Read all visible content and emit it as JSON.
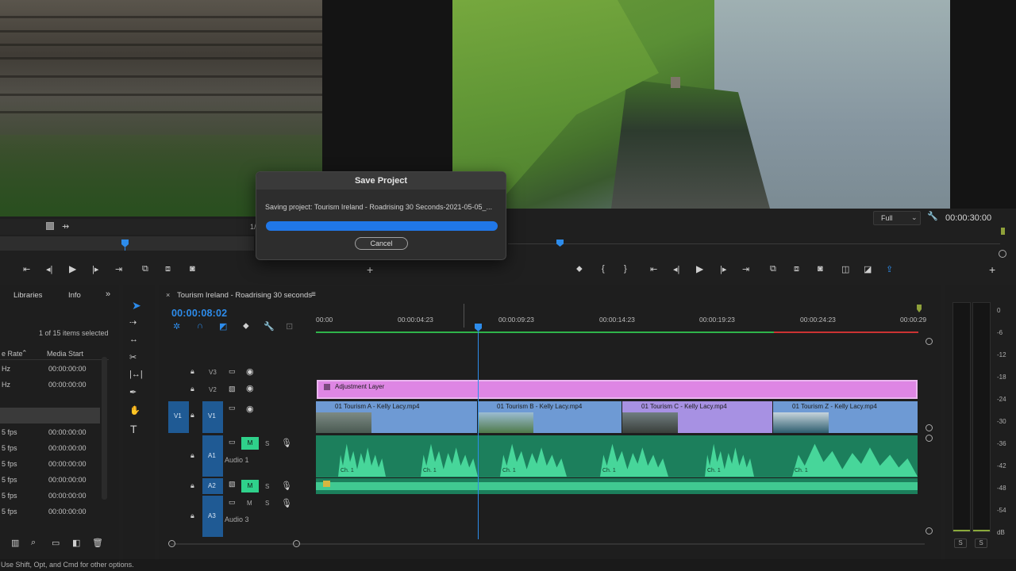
{
  "source_monitor": {
    "zoom_partial": "1/"
  },
  "program_monitor": {
    "resolution": "Full",
    "duration": "00:00:30:00"
  },
  "dialog": {
    "title": "Save Project",
    "message": "Saving project: Tourism Ireland - Roadrising 30 Seconds-2021-05-05_...",
    "progress_percent": 100,
    "cancel_label": "Cancel"
  },
  "project_panel": {
    "tabs": [
      "Libraries",
      "Info"
    ],
    "selection_info": "1 of 15 items selected",
    "columns": [
      "e Rate",
      "Media Start"
    ],
    "rows": [
      {
        "rate": "Hz",
        "start": "00:00:00:00"
      },
      {
        "rate": "Hz",
        "start": "00:00:00:00"
      },
      {
        "rate": "",
        "start": ""
      },
      {
        "rate": "5 fps",
        "start": "00:00:00:00"
      },
      {
        "rate": "5 fps",
        "start": "00:00:00:00"
      },
      {
        "rate": "5 fps",
        "start": "00:00:00:00"
      },
      {
        "rate": "5 fps",
        "start": "00:00:00:00"
      },
      {
        "rate": "5 fps",
        "start": "00:00:00:00"
      },
      {
        "rate": "5 fps",
        "start": "00:00:00:00"
      }
    ]
  },
  "timeline": {
    "sequence_name": "Tourism Ireland - Roadrising 30 seconds",
    "timecode": "00:00:08:02",
    "ruler": [
      "00:00",
      "00:00:04:23",
      "00:00:09:23",
      "00:00:14:23",
      "00:00:19:23",
      "00:00:24:23",
      "00:00:29"
    ],
    "tracks": {
      "v3": "V3",
      "v2": "V2",
      "v1": "V1",
      "v1_src": "V1",
      "a1": "A1",
      "a1_name": "Audio 1",
      "a2": "A2",
      "a3": "A3",
      "a3_name": "Audio 3",
      "m": "M",
      "s": "S"
    },
    "adjustment_layer": "Adjustment Layer",
    "video_clips": [
      "01 Tourism A - Kelly Lacy.mp4",
      "01 Tourism B - Kelly Lacy.mp4",
      "01 Tourism C - Kelly Lacy.mp4",
      "01 Tourism Z - Kelly Lacy.mp4"
    ],
    "channel_label": "Ch. 1"
  },
  "meter": {
    "labels": [
      "0",
      "-6",
      "-12",
      "-18",
      "-24",
      "-30",
      "-36",
      "-42",
      "-48",
      "-54",
      "dB"
    ],
    "solo": [
      "S",
      "S"
    ]
  },
  "status_bar": "Use Shift, Opt, and Cmd for other options."
}
